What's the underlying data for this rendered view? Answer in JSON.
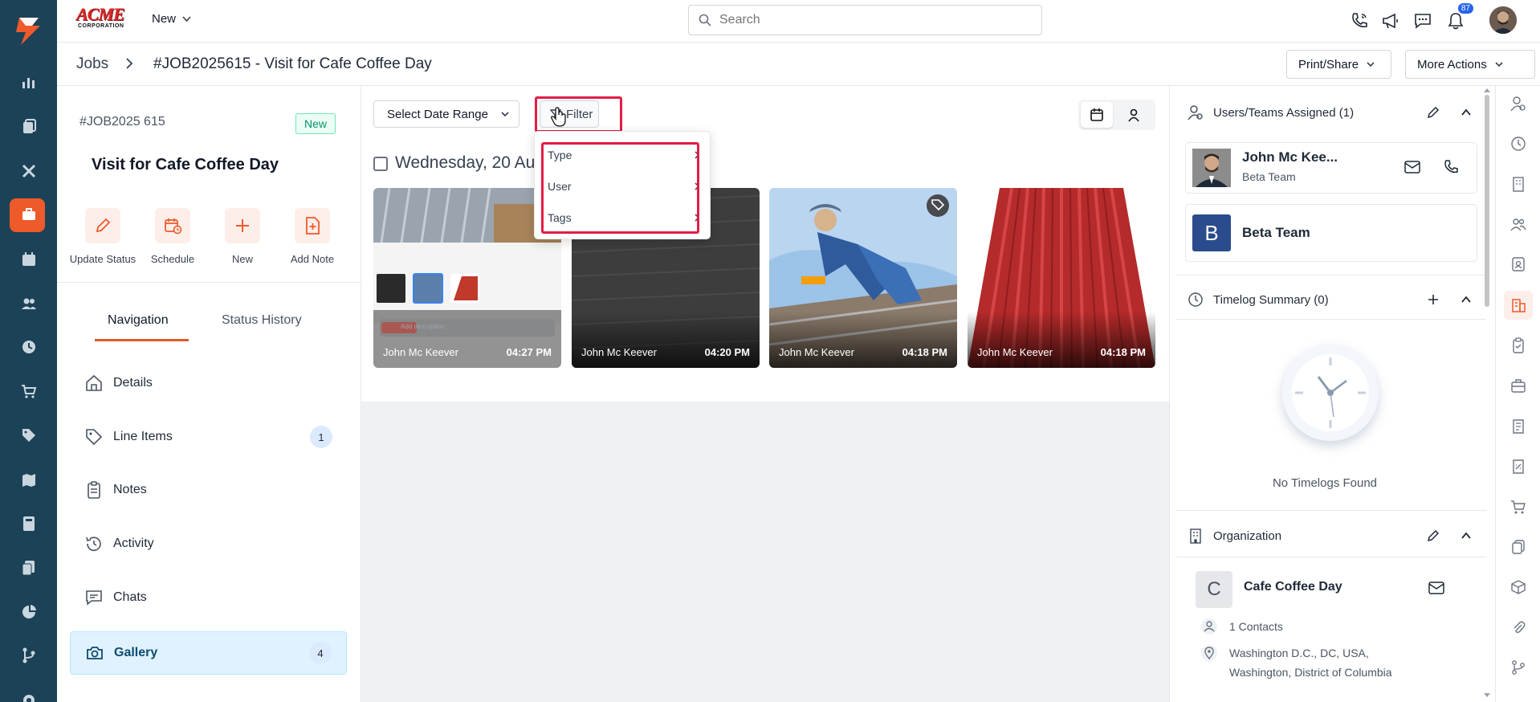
{
  "app": {
    "brand_line1": "ACME",
    "brand_line2": "CORPORATION",
    "new_menu_label": "New"
  },
  "search": {
    "placeholder": "Search"
  },
  "notifications": {
    "count": "87"
  },
  "breadcrumb": {
    "root": "Jobs",
    "title": "#JOB2025615 - Visit for Cafe Coffee Day"
  },
  "header_actions": {
    "print_share": "Print/Share",
    "more_actions": "More Actions"
  },
  "job": {
    "number": "#JOB2025 615",
    "status": "New",
    "title": "Visit for Cafe Coffee Day",
    "quick_actions": [
      "Update Status",
      "Schedule",
      "New",
      "Add Note"
    ]
  },
  "tabs": {
    "navigation": "Navigation",
    "status_history": "Status History"
  },
  "nav_items": [
    {
      "label": "Details"
    },
    {
      "label": "Line Items",
      "count": "1"
    },
    {
      "label": "Notes"
    },
    {
      "label": "Activity"
    },
    {
      "label": "Chats"
    },
    {
      "label": "Gallery",
      "count": "4"
    }
  ],
  "gallery": {
    "date_range_label": "Select Date Range",
    "filter_label": "Filter",
    "day_heading": "Wednesday, 20 Au",
    "add_description_placeholder": "Add description",
    "photos": [
      {
        "user": "John Mc Keever",
        "time": "04:27 PM"
      },
      {
        "user": "John Mc Keever",
        "time": "04:20 PM"
      },
      {
        "user": "John Mc Keever",
        "time": "04:18 PM"
      },
      {
        "user": "John Mc Keever",
        "time": "04:18 PM"
      }
    ]
  },
  "filter_menu": {
    "items": [
      "Type",
      "User",
      "Tags"
    ]
  },
  "right_panel": {
    "assigned_header": "Users/Teams Assigned (1)",
    "user_name": "John Mc Kee...",
    "user_team": "Beta Team",
    "team_initial": "B",
    "team_name": "Beta Team",
    "timelog_header": "Timelog Summary (0)",
    "no_timelogs": "No Timelogs Found",
    "org_header": "Organization",
    "org_initial": "C",
    "org_name": "Cafe Coffee Day",
    "contacts": "1 Contacts",
    "address_line1": "Washington D.C., DC, USA,",
    "address_line2": "Washington, District of Columbia"
  },
  "colors": {
    "rail": "#1c4257",
    "accent": "#ef5a2a",
    "highlight": "#e11d48"
  }
}
